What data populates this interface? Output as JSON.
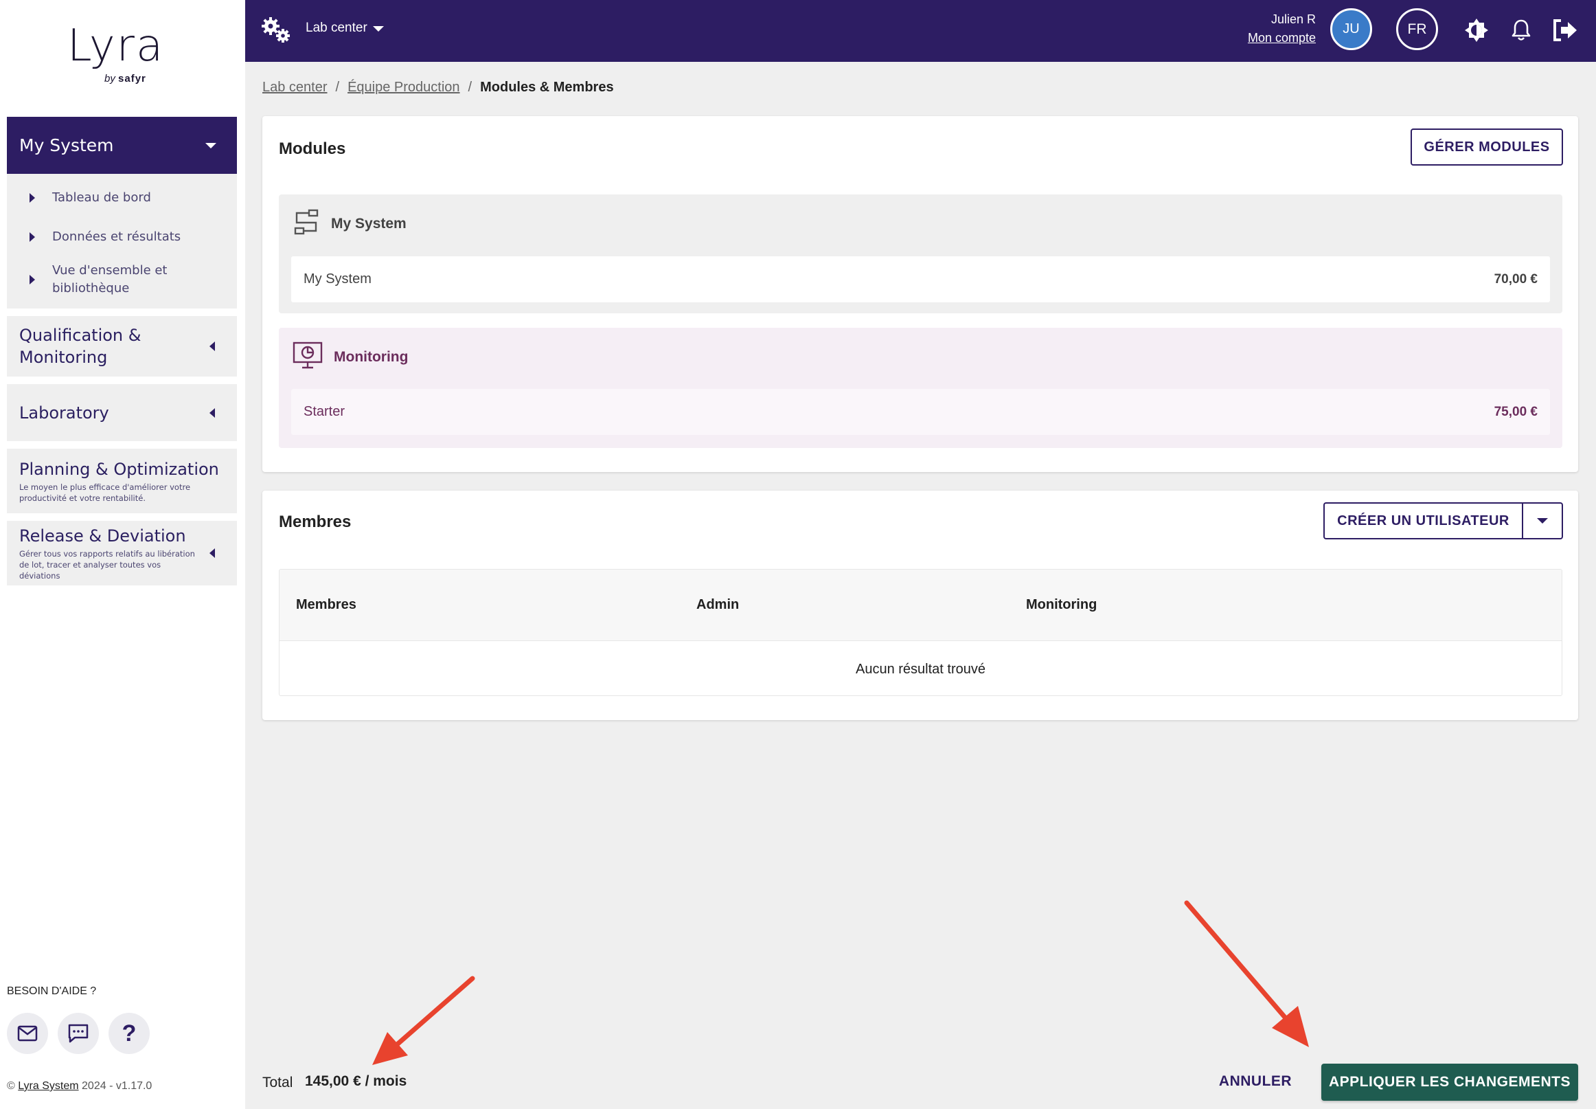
{
  "brand": {
    "logo_text": "Lyra",
    "by": "by",
    "company": "safyr"
  },
  "sidebar": {
    "active_group": "My System",
    "sub_items": [
      {
        "label": "Tableau de bord"
      },
      {
        "label": "Données et résultats"
      },
      {
        "label": "Vue d'ensemble et bibliothèque"
      }
    ],
    "groups": [
      {
        "title": "Qualification & Monitoring",
        "subtitle": ""
      },
      {
        "title": "Laboratory",
        "subtitle": ""
      },
      {
        "title": "Planning & Optimization",
        "subtitle": "Le moyen le plus efficace d'améliorer votre productivité et votre rentabilité."
      },
      {
        "title": "Release & Deviation",
        "subtitle": "Gérer tous vos rapports relatifs au libération de lot, tracer et analyser toutes vos déviations"
      }
    ],
    "help_label": "BESOIN D'AIDE ?",
    "help_icons": [
      "mail-icon",
      "chat-icon",
      "question-icon"
    ],
    "copyright_prefix": "©",
    "copyright_link": "Lyra System",
    "copyright_suffix": "2024 - v1.17.0"
  },
  "header": {
    "context": "Lab center",
    "user_name": "Julien R",
    "account_link": "Mon compte",
    "avatar_initials": "JU",
    "language": "FR",
    "icons": [
      "settings-gears-icon",
      "theme-toggle-icon",
      "bell-icon",
      "logout-icon"
    ]
  },
  "breadcrumb": {
    "items": [
      "Lab center",
      "Équipe Production"
    ],
    "current": "Modules & Membres"
  },
  "modules": {
    "title": "Modules",
    "manage_button": "GÉRER MODULES",
    "list": [
      {
        "name": "My System",
        "row_label": "My System",
        "price": "70,00 €"
      },
      {
        "name": "Monitoring",
        "row_label": "Starter",
        "price": "75,00 €"
      }
    ]
  },
  "members": {
    "title": "Membres",
    "create_button": "CRÉER UN UTILISATEUR",
    "columns": [
      "Membres",
      "Admin",
      "Monitoring"
    ],
    "empty_text": "Aucun résultat trouvé"
  },
  "footer": {
    "total_label": "Total",
    "total_value": "145,00 € / mois",
    "cancel": "ANNULER",
    "apply": "APPLIQUER LES CHANGEMENTS"
  },
  "colors": {
    "primary": "#2d1d63",
    "accent_green": "#1f5c50",
    "avatar_blue": "#3a7bc8",
    "monitoring_tint": "#f5eef5",
    "monitoring_text": "#6b2d5c",
    "annotation_arrow": "#e8432e"
  }
}
